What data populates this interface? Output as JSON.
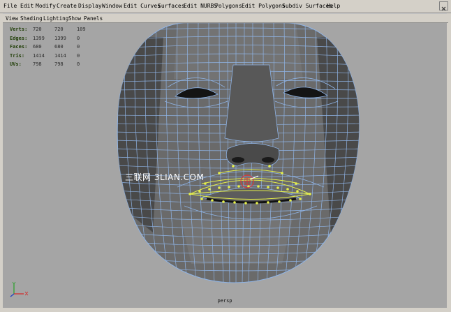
{
  "menu": {
    "items": [
      "File",
      "Edit",
      "Modify",
      "Create",
      "Display",
      "Window",
      "Edit Curves",
      "Surfaces",
      "Edit NURBS",
      "Polygons",
      "Edit Polygons",
      "Subdiv Surfaces",
      "Help"
    ]
  },
  "panel_menu": {
    "items": [
      "View",
      "Shading",
      "Lighting",
      "Show",
      "Panels"
    ]
  },
  "hud": {
    "rows": [
      {
        "label": "Verts:",
        "a": "720",
        "b": "720",
        "c": "109"
      },
      {
        "label": "Edges:",
        "a": "1399",
        "b": "1399",
        "c": "0"
      },
      {
        "label": "Faces:",
        "a": "680",
        "b": "680",
        "c": "0"
      },
      {
        "label": "Tris:",
        "a": "1414",
        "b": "1414",
        "c": "0"
      },
      {
        "label": "UVs:",
        "a": "798",
        "b": "798",
        "c": "0"
      }
    ]
  },
  "viewport": {
    "camera_label": "persp",
    "watermark": "三联网 3LIAN.COM"
  },
  "colors": {
    "menu_bg": "#d4d0c8",
    "viewport_bg": "#a5a5a5",
    "mesh_edge": "#8fb4e6",
    "face_fill": "#6e6e6e",
    "selection": "#e6f04a",
    "manipulator": "#d93a3a"
  },
  "icons": {
    "axis": "axis-indicator-icon",
    "close": "window-close-icon",
    "manipulator": "move-manipulator-icon"
  }
}
